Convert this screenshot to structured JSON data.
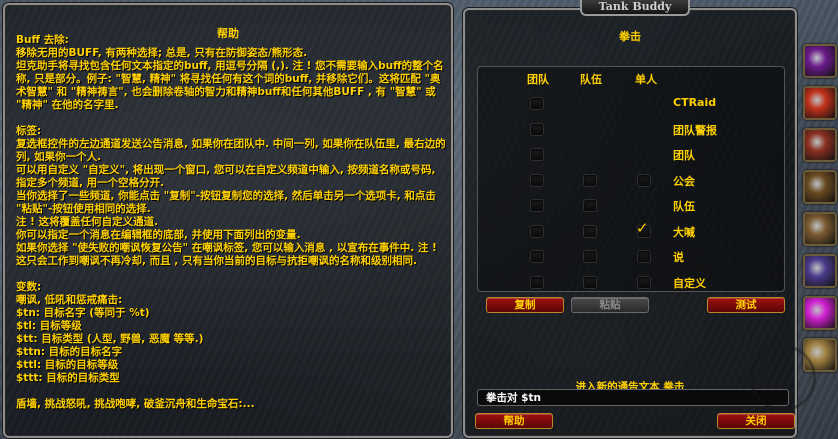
{
  "help": {
    "title": "帮助",
    "body": "Buff 去除:\n移除无用的BUFF, 有两种选择; 总是, 只有在防御姿态/熊形态.\n坦克助手将寻找包含任何文本指定的buff, 用逗号分隔 (,). 注 ! 您不需要输入buff的整个名称, 只是部分。例子: \"智慧, 精神\" 将寻找任何有这个词的buff, 并移除它们。这将匹配 \"奥术智慧\" 和 \"精神祷言\", 也会删除卷轴的智力和精神buff和任何其他BUFF , 有 \"智慧\" 或 \"精神\" 在他的名字里.\n\n标签:\n复选框控件的左边通道发送公告消息, 如果你在团队中. 中间一列, 如果你在队伍里, 最右边的列, 如果你一个人.\n可以用自定义 \"自定义\", 将出现一个窗口, 您可以在自定义频道中输入, 按频道名称或号码, 指定多个频道, 用一个空格分开.\n当你选择了一些频道, 你能点击 \"复制\"-按钮复制您的选择, 然后单击另一个选项卡, 和点击 \"粘贴\"-按钮使用相同的选择.\n注 ! 这将覆盖任何自定义通道.\n你可以指定一个消息在编辑框的底部, 并使用下面列出的变量.\n如果你选择 \"使失败的嘲讽恢复公告\" 在嘲讽标签, 您可以输入消息 , 以宣布在事件中. 注 ! 这只会工作到嘲讽不再冷却, 而且 , 只有当你当前的目标与抗拒嘲讽的名称和级别相同.\n\n变数:\n嘲讽, 低吼和惩戒痛击:\n$tn: 目标名字 (等同于 %t)\n$tl: 目标等级\n$tt: 目标类型 (人型, 野兽, 恶魔 等等.)\n$ttn: 目标的目标名字\n$ttl: 目标的目标等级\n$ttt: 目标的目标类型\n\n盾墙, 挑战怒吼, 挑战咆哮, 破釜沉舟和生命宝石:..."
  },
  "app": {
    "title": "Tank Buddy",
    "heading": "拳击"
  },
  "grid": {
    "columns": [
      "团队",
      "队伍",
      "单人"
    ],
    "rows": [
      {
        "label": "CTRaid",
        "raid": false,
        "party": null,
        "solo": null
      },
      {
        "label": "团队警报",
        "raid": false,
        "party": null,
        "solo": null
      },
      {
        "label": "团队",
        "raid": false,
        "party": null,
        "solo": null
      },
      {
        "label": "公会",
        "raid": false,
        "party": false,
        "solo": false
      },
      {
        "label": "队伍",
        "raid": false,
        "party": false,
        "solo": null
      },
      {
        "label": "大喊",
        "raid": false,
        "party": false,
        "solo": true
      },
      {
        "label": "说",
        "raid": false,
        "party": false,
        "solo": false
      },
      {
        "label": "自定义",
        "raid": false,
        "party": false,
        "solo": false
      }
    ]
  },
  "buttons": {
    "copy": "复制",
    "paste": "粘贴",
    "test": "测试",
    "help": "帮助",
    "close": "关闭"
  },
  "message": {
    "label": "进入新的通告文本 拳击",
    "value": "拳击对 $tn"
  },
  "side_icons": [
    {
      "name": "shadow-orb-icon",
      "color": "#6a1a8a"
    },
    {
      "name": "fire-shout-icon",
      "color": "#c0301a"
    },
    {
      "name": "sword-strike-icon",
      "color": "#8a3020"
    },
    {
      "name": "warrior-helm-icon",
      "color": "#6a4a20"
    },
    {
      "name": "dwarf-face-icon",
      "color": "#7a5a30"
    },
    {
      "name": "arcane-icon",
      "color": "#4a3a8a"
    },
    {
      "name": "magenta-orb-icon",
      "color": "#d020d0"
    },
    {
      "name": "fist-icon",
      "color": "#a08040"
    }
  ]
}
